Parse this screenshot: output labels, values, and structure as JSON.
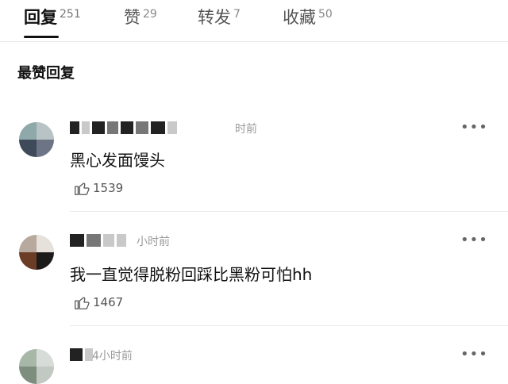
{
  "tabs": [
    {
      "label": "回复",
      "count": "251",
      "active": true
    },
    {
      "label": "赞",
      "count": "29",
      "active": false
    },
    {
      "label": "转发",
      "count": "7",
      "active": false
    },
    {
      "label": "收藏",
      "count": "50",
      "active": false
    }
  ],
  "section_title": "最赞回复",
  "comments": [
    {
      "time": "时前",
      "text": "黑心发面馒头",
      "likes": "1539",
      "more": "•••",
      "like_icon": "thumbs-up-icon"
    },
    {
      "time": "小时前",
      "text": "我一直觉得脱粉回踩比黑粉可怕hh",
      "likes": "1467",
      "more": "•••",
      "like_icon": "thumbs-up-icon"
    },
    {
      "time": "4小时前",
      "more": "•••"
    }
  ]
}
